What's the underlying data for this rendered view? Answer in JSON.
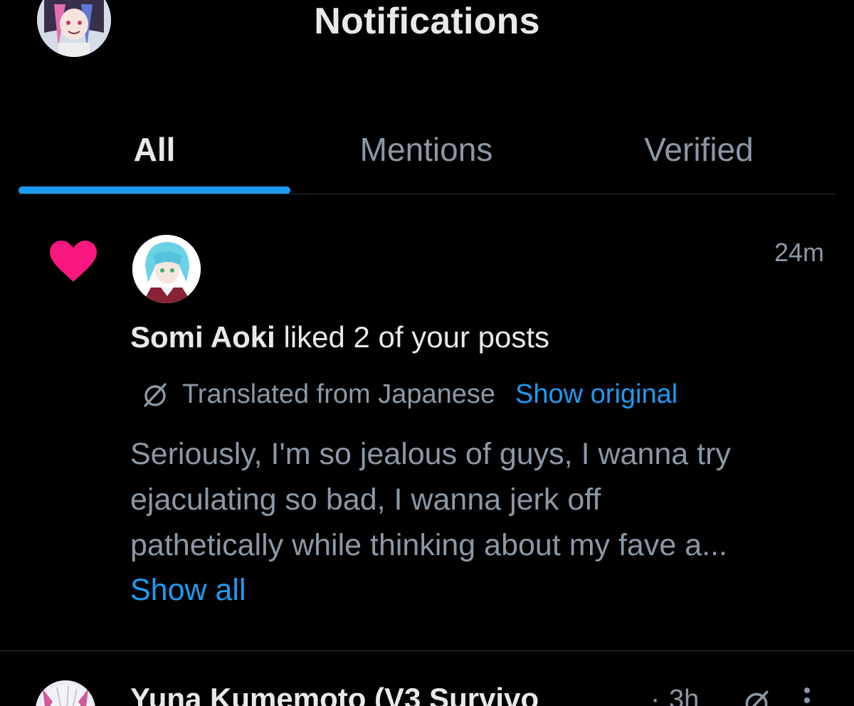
{
  "header": {
    "title": "Notifications",
    "avatar_icon": "profile-avatar"
  },
  "tabs": [
    {
      "label": "All",
      "active": true
    },
    {
      "label": "Mentions",
      "active": false
    },
    {
      "label": "Verified",
      "active": false
    }
  ],
  "notifications": [
    {
      "type_icon": "heart-icon",
      "type_color": "#f91880",
      "user": "Somi Aoki",
      "action": "liked 2 of your posts",
      "time": "24m",
      "translation": {
        "label": "Translated from Japanese",
        "link": "Show original"
      },
      "body_lines": [
        "Seriously, I'm so jealous of guys, I wanna try",
        "ejaculating so bad, I wanna jerk off",
        "pathetically while thinking about my fave a..."
      ],
      "show_all": "Show all"
    },
    {
      "user": "Yuna Kumemoto (V3 Survivo",
      "separator": "·",
      "time": "3h",
      "translate_icon": "translate-icon",
      "more_icon": "more-icon"
    }
  ],
  "colors": {
    "background": "#000000",
    "primary_text": "#e7e9ea",
    "secondary_text": "#8b98a5",
    "accent": "#1d9bf0",
    "like": "#f91880",
    "divider": "#2f3336"
  }
}
